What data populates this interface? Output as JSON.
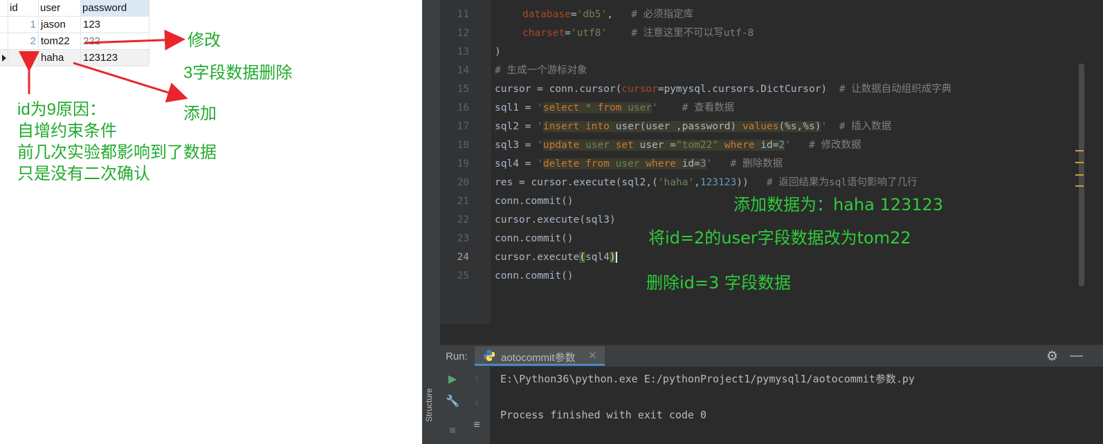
{
  "grid": {
    "columns": [
      "id",
      "user",
      "password"
    ],
    "rows": [
      {
        "id": "1",
        "user": "jason",
        "password": "123"
      },
      {
        "id": "2",
        "user": "tom22",
        "password": "222"
      },
      {
        "id": "9",
        "user": "haha",
        "password": "123123"
      }
    ]
  },
  "annotations_left": {
    "modify": "修改",
    "deleted": "3字段数据删除",
    "added": "添加",
    "reason_lines": [
      "id为9原因：",
      "自增约束条件",
      "前几次实验都影响到了数据",
      "只是没有二次确认"
    ]
  },
  "editor": {
    "line_numbers": [
      "11",
      "12",
      "13",
      "14",
      "15",
      "16",
      "17",
      "18",
      "19",
      "20",
      "21",
      "22",
      "23",
      "24",
      "25"
    ],
    "current_line": "24",
    "code": {
      "l11_key": "database",
      "l11_eq": "=",
      "l11_val": "'db5'",
      "l11_comma": ",",
      "l11_comment": "# 必须指定库",
      "l12_key": "charset",
      "l12_eq": "=",
      "l12_val": "'utf8'",
      "l12_comment": "# 注意这里不可以写utf-8",
      "l13": ")",
      "l14": "# 生成一个游标对象",
      "l15_a": "cursor = conn.cursor(",
      "l15_param": "cursor",
      "l15_b": "=pymysql.cursors.DictCursor)",
      "l15_comment": "# 让数据自动组织成字典",
      "l16_a": "sql1 = ",
      "l16_q1": "'",
      "l16_k1": "select",
      "l16_b": " * ",
      "l16_k2": "from",
      "l16_c": " user",
      "l16_q2": "'",
      "l16_comment": "# 查看数据",
      "l17_a": "sql2 = ",
      "l17_q1": "'",
      "l17_k1": "insert into",
      "l17_b": " user(user ,password) ",
      "l17_k2": "values",
      "l17_c": "(%s,%s)",
      "l17_q2": "'",
      "l17_comment": "# 插入数据",
      "l18_a": "sql3 = ",
      "l18_q1": "'",
      "l18_k1": "update",
      "l18_b": " user ",
      "l18_k2": "set",
      "l18_c": " user =",
      "l18_s": "\"tom22\"",
      "l18_d": " ",
      "l18_k3": "where",
      "l18_e": " id=",
      "l18_n": "2",
      "l18_q2": "'",
      "l18_comment": "# 修改数据",
      "l19_a": "sql4 = ",
      "l19_q1": "'",
      "l19_k1": "delete from",
      "l19_b": " user ",
      "l19_k2": "where",
      "l19_c": " id=",
      "l19_n": "3",
      "l19_q2": "'",
      "l19_comment": "# 删除数据",
      "l20_a": "res = cursor.execute(sql2,(",
      "l20_s": "'haha'",
      "l20_b": ",",
      "l20_n": "123123",
      "l20_c": "))",
      "l20_comment": "# 返回结果为sql语句影响了几行",
      "l21": "conn.commit()",
      "l22": "cursor.execute(sql3)",
      "l23": "conn.commit()",
      "l24_a": "cursor.execute",
      "l24_p1": "(",
      "l24_b": "sql4",
      "l24_p2": ")",
      "l25": "conn.commit()"
    },
    "notes": {
      "add": "添加数据为：haha 123123",
      "update": "将id=2的user字段数据改为tom22",
      "delete": "删除id=3 字段数据"
    }
  },
  "run_panel": {
    "label": "Run:",
    "tab_name": "aotocommit参数",
    "side_label": "Structure",
    "output": [
      "E:\\Python36\\python.exe E:/pythonProject1/pymysql1/aotocommit参数.py",
      "",
      "Process finished with exit code 0"
    ]
  },
  "colors": {
    "annotation_green": "#22aa2e",
    "arrow_red": "#e8262b",
    "ide_background": "#2b2b2b",
    "keyword_orange": "#cc7832",
    "string_green": "#6a8759"
  }
}
